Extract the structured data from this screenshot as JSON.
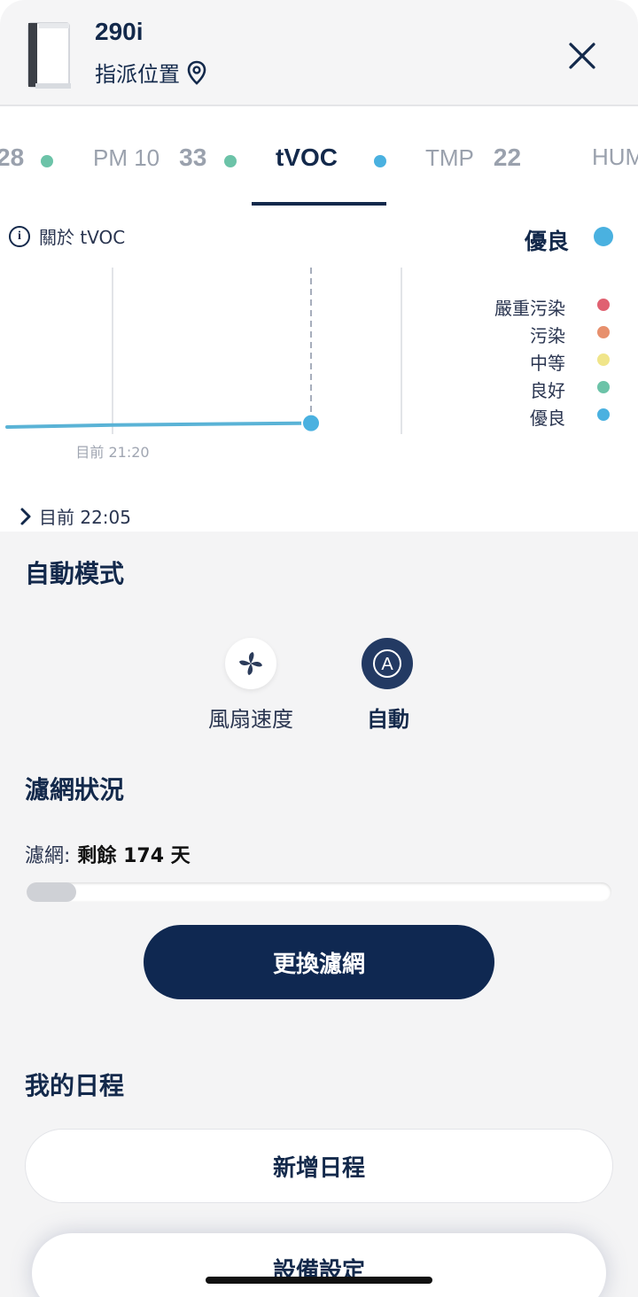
{
  "header": {
    "device_name": "290i",
    "location_label": "指派位置"
  },
  "tabs": [
    {
      "label": "",
      "value": "28",
      "dot_color": "#6cc3a8"
    },
    {
      "label": "PM 10",
      "value": "33",
      "dot_color": "#6cc3a8"
    },
    {
      "label": "tVOC",
      "value": "",
      "dot_color": "#4ab1e0",
      "active": true
    },
    {
      "label": "TMP",
      "value": "22",
      "dot_color": ""
    },
    {
      "label": "HUM",
      "value": "",
      "dot_color": ""
    }
  ],
  "chart": {
    "info_label": "關於 tVOC",
    "status_label": "優良",
    "status_color": "#4ab1e0",
    "time_label": "目前 21:20",
    "now_label": "目前 22:05",
    "line_color": "#5ab3d6"
  },
  "chart_data": {
    "type": "line",
    "x": [
      "",
      "21:20",
      "22:05"
    ],
    "series": [
      {
        "values": [
          1,
          1,
          1
        ]
      }
    ],
    "legend": [
      {
        "label": "嚴重污染",
        "color": "#e06171"
      },
      {
        "label": "污染",
        "color": "#e7906d"
      },
      {
        "label": "中等",
        "color": "#f0e58a"
      },
      {
        "label": "良好",
        "color": "#6cc3a8"
      },
      {
        "label": "優良",
        "color": "#4ab1e0"
      }
    ]
  },
  "mode": {
    "title": "自動模式",
    "fan_label": "風扇速度",
    "auto_label": "自動"
  },
  "filter": {
    "title": "濾網狀況",
    "label": "濾網:",
    "remaining": "剩餘 174 天",
    "progress_fraction": 0.055,
    "replace_button": "更換濾網"
  },
  "schedule": {
    "title": "我的日程",
    "add_button": "新增日程",
    "settings_button": "設備設定"
  }
}
